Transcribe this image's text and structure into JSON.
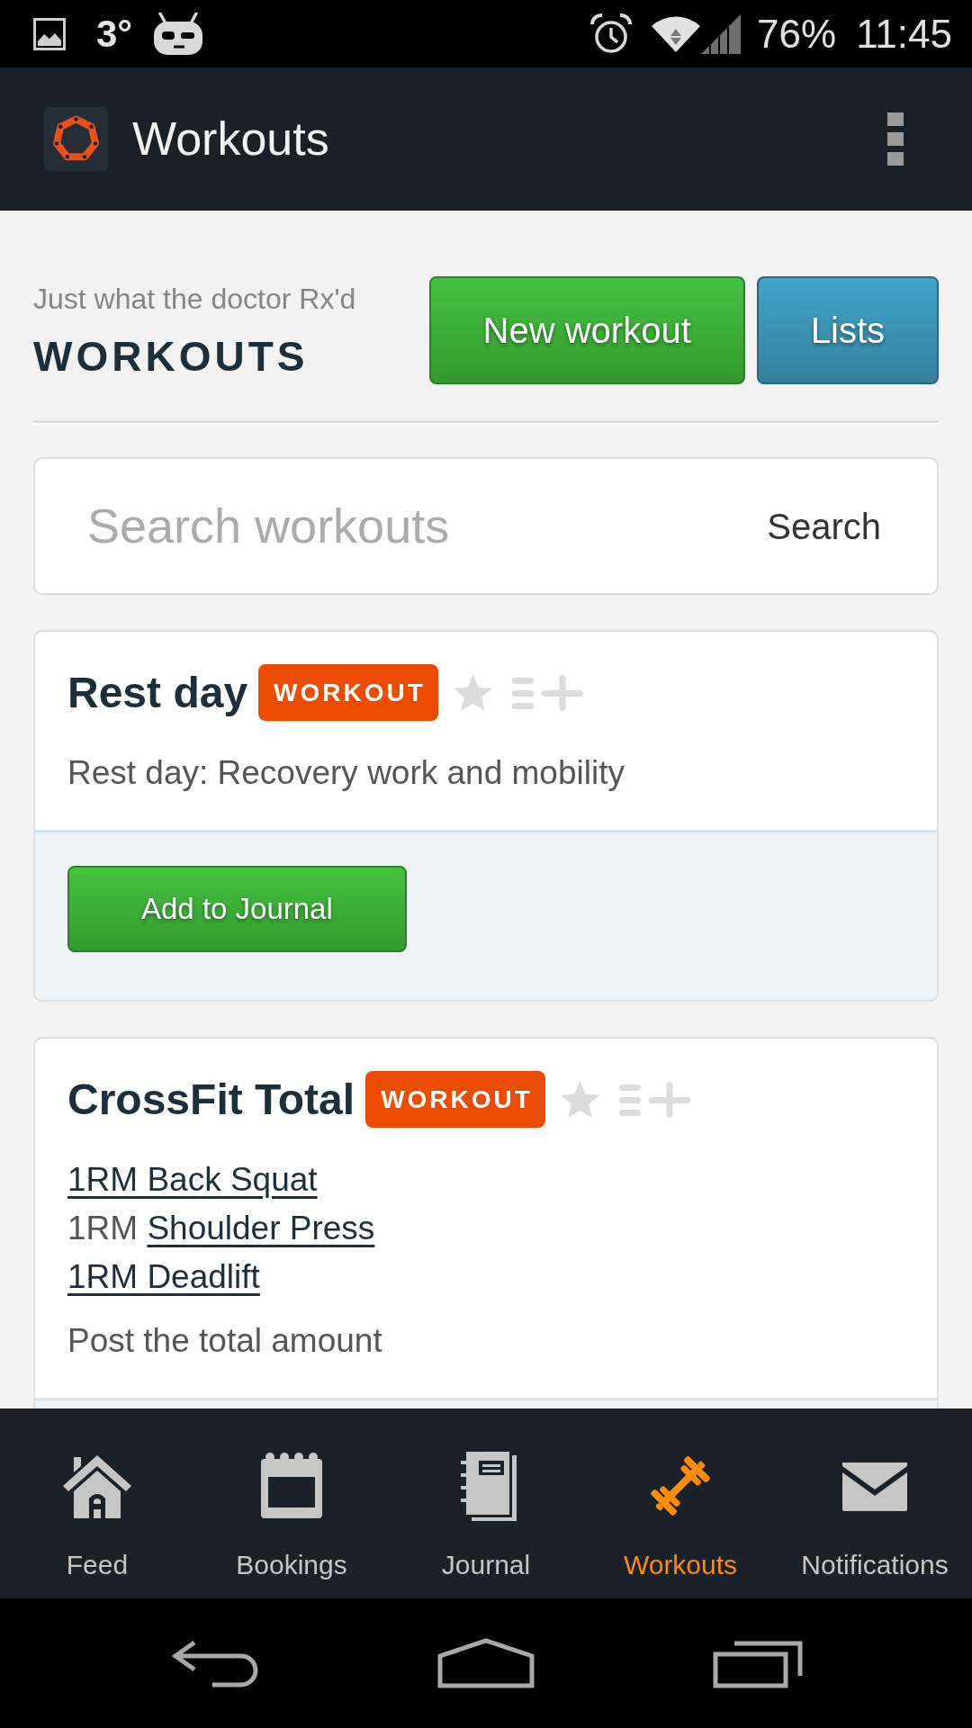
{
  "status_bar": {
    "temperature": "3°",
    "battery": "76%",
    "time": "11:45"
  },
  "app_bar": {
    "title": "Workouts"
  },
  "header": {
    "tagline": "Just what the doctor Rx'd",
    "title": "WORKOUTS",
    "buttons": [
      {
        "label": "New workout",
        "kind": "success"
      },
      {
        "label": "Lists",
        "kind": "info"
      }
    ]
  },
  "search": {
    "placeholder": "Search workouts",
    "button": "Search"
  },
  "workouts": [
    {
      "title": "Rest day",
      "badge": "WORKOUT",
      "starred": false,
      "description": "Rest day: Recovery work and mobility",
      "action": "Add to Journal"
    },
    {
      "title": "CrossFit Total",
      "badge": "WORKOUT",
      "starred": false,
      "exercises": [
        {
          "link": "1RM Back Squat"
        },
        {
          "text": "1RM",
          "link": "Shoulder Press"
        },
        {
          "link": "1RM Deadlift"
        }
      ],
      "description": "Post the total amount"
    }
  ],
  "bottom_nav": [
    {
      "label": "Feed",
      "selected": false
    },
    {
      "label": "Bookings",
      "selected": false
    },
    {
      "label": "Journal",
      "selected": false
    },
    {
      "label": "Workouts",
      "selected": true
    },
    {
      "label": "Notifications",
      "selected": false
    }
  ]
}
